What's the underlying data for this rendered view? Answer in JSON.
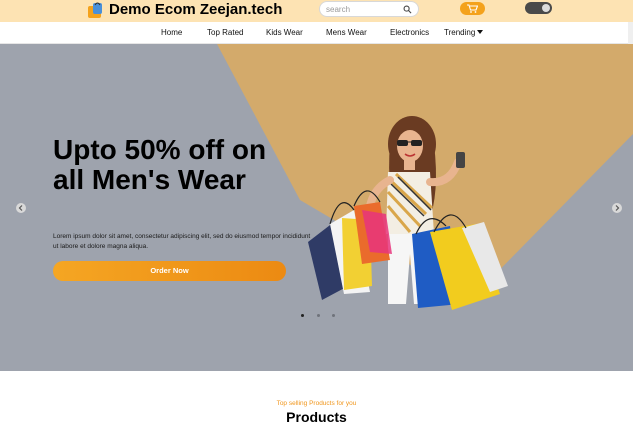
{
  "header": {
    "brand": "Demo Ecom Zeejan.tech",
    "search_placeholder": "search",
    "colors": {
      "bar": "#fde3b3",
      "accent": "#f4a21c"
    }
  },
  "nav": {
    "items": [
      {
        "label": "Home"
      },
      {
        "label": "Top Rated"
      },
      {
        "label": "Kids Wear"
      },
      {
        "label": "Mens Wear"
      },
      {
        "label": "Electronics"
      },
      {
        "label": "Trending"
      }
    ]
  },
  "hero": {
    "headline": "Upto 50% off on all Men's Wear",
    "description": "Lorem ipsum dolor sit amet, consectetur adipiscing elit, sed do eiusmod tempor incididunt ut labore et dolore magna aliqua.",
    "cta": "Order Now",
    "slides": 3,
    "active_slide": 1,
    "colors": {
      "background": "#9ea3ad",
      "shape": "#d3aa6b"
    }
  },
  "products": {
    "subtitle": "Top selling Products for you",
    "title": "Products"
  }
}
